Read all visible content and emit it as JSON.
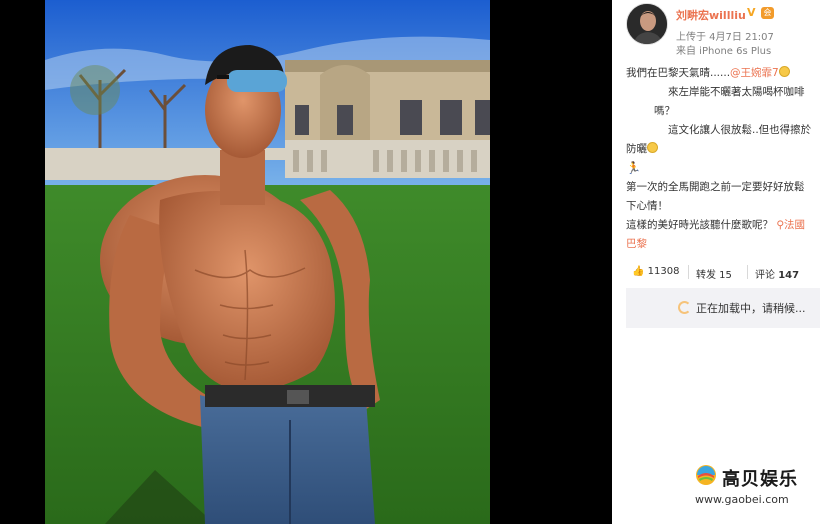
{
  "post": {
    "username": "刘畊宏willliu",
    "verified_mark": "V",
    "member_mark": "会",
    "upload_time": "上传于 4月7日 21:07",
    "device": "来自 iPhone 6s Plus",
    "content_lines": [
      {
        "text": "我們在巴黎天氣晴......",
        "mention": "@王婉霏7",
        "emoji": true
      },
      {
        "text": "來左岸能不曬著太陽喝杯咖啡"
      },
      {
        "text": "嗎？"
      },
      {
        "text": "這文化讓人很放鬆..但也得擦於"
      },
      {
        "text": "防曬",
        "emoji": true
      },
      {
        "runner": true
      },
      {
        "text": "第一次的全馬開跑之前一定要好好放鬆"
      },
      {
        "text": "下心情！"
      },
      {
        "text": "這樣的美好時光該聽什麼歌呢？",
        "location": "法國"
      },
      {
        "location": "巴黎"
      }
    ]
  },
  "actions": {
    "like_count": "11308",
    "repost_label": "转发 15",
    "comment_label": "评论",
    "comment_count": "147"
  },
  "loading": {
    "text": "正在加载中，请稍候..."
  },
  "watermark": {
    "title": "高贝娱乐",
    "url": "www.gaobei.com"
  },
  "colors": {
    "accent": "#eb7350",
    "loading_bg": "#f2f2f5",
    "viewer_bg": "#000000"
  }
}
